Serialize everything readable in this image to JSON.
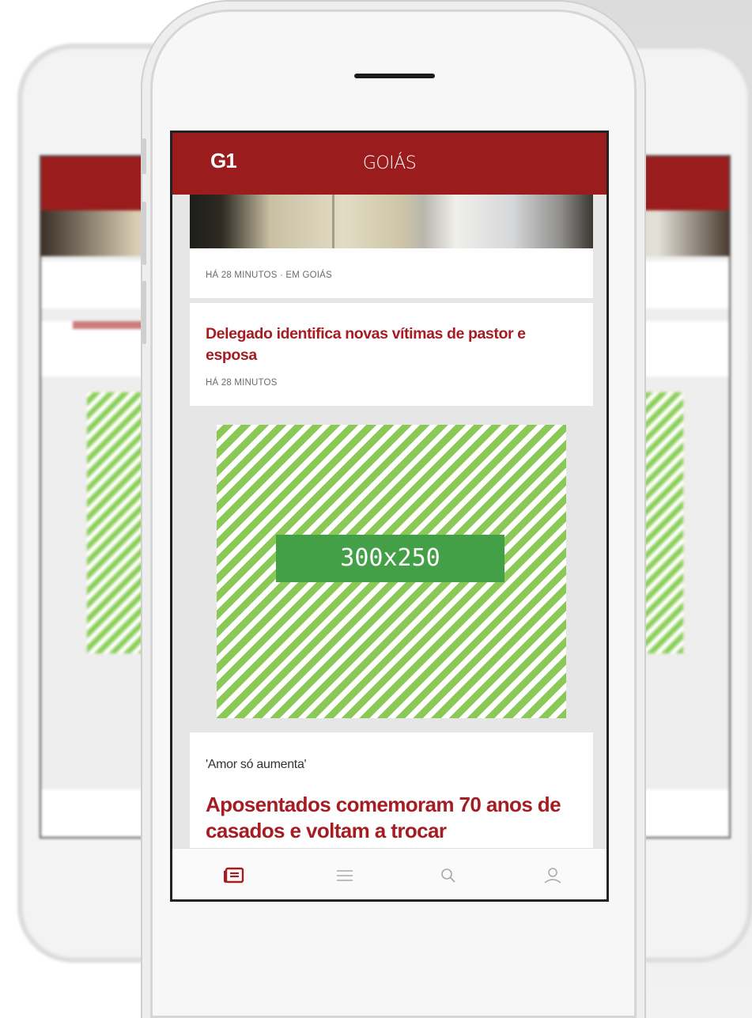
{
  "app": {
    "logo": "G1",
    "region": "GOIÁS"
  },
  "feed": {
    "top_card": {
      "meta": "HÁ 28 MINUTOS · EM GOIÁS"
    },
    "news_card": {
      "headline": "Delegado identifica novas vítimas de pastor e esposa",
      "meta": "HÁ 28 MINUTOS"
    },
    "ad": {
      "label": "300x250"
    },
    "story_card": {
      "kicker": "'Amor só aumenta'",
      "headline": "Aposentados comemoram 70 anos de casados e voltam a trocar"
    }
  },
  "tab_bar": {
    "items": [
      {
        "icon": "news-icon",
        "active": true
      },
      {
        "icon": "menu-icon",
        "active": false
      },
      {
        "icon": "search-icon",
        "active": false
      },
      {
        "icon": "user-icon",
        "active": false
      }
    ]
  },
  "colors": {
    "brand": "#9b1c1c",
    "headline": "#a51c22",
    "ad_stripe": "#8bc956",
    "ad_label_bg": "#43a047"
  }
}
